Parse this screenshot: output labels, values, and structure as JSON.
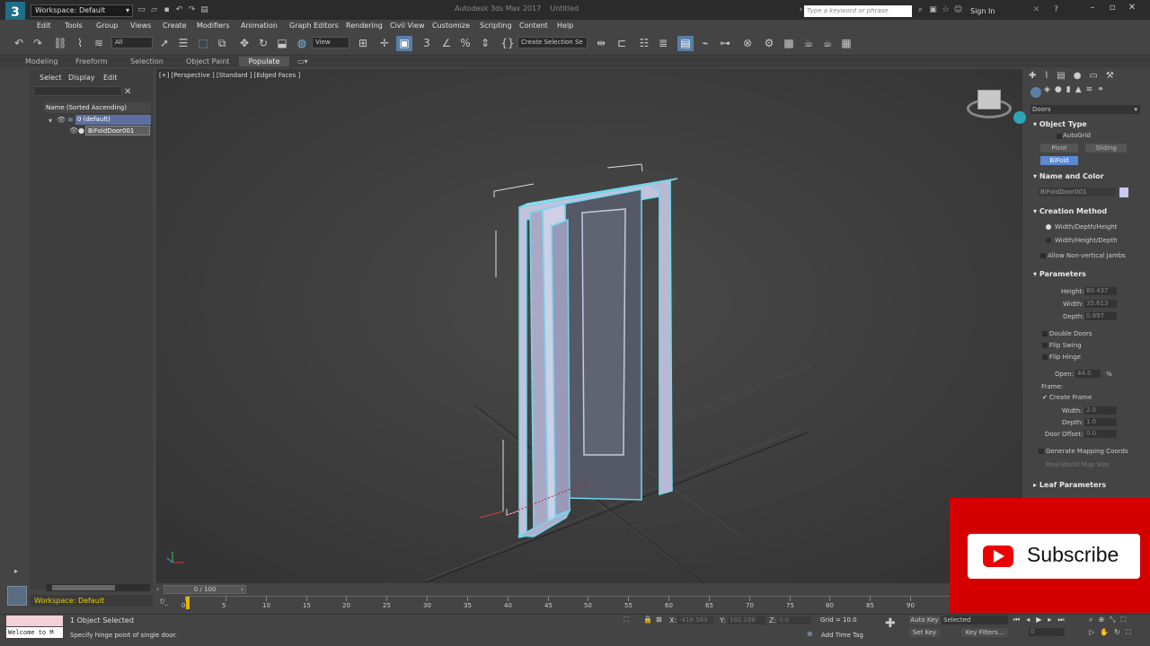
{
  "titlebar": {
    "app_icon": "3",
    "workspace": "Workspace: Default",
    "title": "Autodesk 3ds Max 2017",
    "file": "Untitled",
    "search_placeholder": "Type a keyword or phrase",
    "sign_in": "Sign In"
  },
  "menus": [
    "Edit",
    "Tools",
    "Group",
    "Views",
    "Create",
    "Modifiers",
    "Animation",
    "Graph Editors",
    "Rendering",
    "Civil View",
    "Customize",
    "Scripting",
    "Content",
    "Help"
  ],
  "toolbar": {
    "filter": "All",
    "ref_coord": "View",
    "selection_set": "Create Selection Se"
  },
  "ribbon_tabs": [
    "Modeling",
    "Freeform",
    "Selection",
    "Object Paint",
    "Populate"
  ],
  "scene_explorer": {
    "tabs": [
      "Select",
      "Display",
      "Edit"
    ],
    "column": "Name (Sorted Ascending)",
    "layer": "0 (default)",
    "object": "BiFoldDoor001"
  },
  "viewport": {
    "label": "[+] [Perspective ] [Standard ] [Edged Faces ]"
  },
  "command_panel": {
    "category": "Doors",
    "object_type_title": "Object Type",
    "autogrid": "AutoGrid",
    "types": [
      "Pivot",
      "Sliding",
      "BiFold"
    ],
    "name_color_title": "Name and Color",
    "object_name": "BiFoldDoor001",
    "object_color": "#c8c8f0",
    "creation_title": "Creation Method",
    "creation_options": [
      "Width/Depth/Height",
      "Width/Height/Depth"
    ],
    "allow_jambs": "Allow Non-vertical Jambs",
    "parameters_title": "Parameters",
    "height_label": "Height:",
    "height_val": "80.437",
    "width_label": "Width:",
    "width_val": "35.613",
    "depth_label": "Depth:",
    "depth_val": "0.897",
    "double_doors": "Double Doors",
    "flip_swing": "Flip Swing",
    "flip_hinge": "Flip Hinge",
    "open_label": "Open:",
    "open_val": "44.0",
    "open_unit": "%",
    "frame_label": "Frame:",
    "create_frame": "Create Frame",
    "frame_width_label": "Width:",
    "frame_width_val": "2.0",
    "frame_depth_label": "Depth:",
    "frame_depth_val": "1.0",
    "door_offset_label": "Door Offset:",
    "door_offset_val": "0.0",
    "gen_mapping": "Generate Mapping Coords",
    "real_world": "Real-World Map Size",
    "leaf_title": "Leaf Parameters"
  },
  "timeline": {
    "frame": "0 / 100",
    "ticks": [
      "0",
      "5",
      "10",
      "15",
      "20",
      "25",
      "30",
      "35",
      "40",
      "45",
      "50",
      "55",
      "60",
      "65",
      "70",
      "75",
      "80",
      "85",
      "90"
    ]
  },
  "status": {
    "workspace": "Workspace: Default",
    "script_field": "Welcome to M",
    "selected": "1 Object Selected",
    "prompt": "Specify hinge point of single door.",
    "x_label": "X:",
    "x_val": "-418.583",
    "y_label": "Y:",
    "y_val": "192.186",
    "z_label": "Z:",
    "z_val": "0.0",
    "grid": "Grid = 10.0",
    "add_time_tag": "Add Time Tag",
    "auto_key": "Auto Key",
    "set_key": "Set Key",
    "selected_dd": "Selected",
    "key_filters": "Key Filters...",
    "frame_val": "0"
  },
  "overlay": {
    "subscribe": "Subscribe"
  }
}
